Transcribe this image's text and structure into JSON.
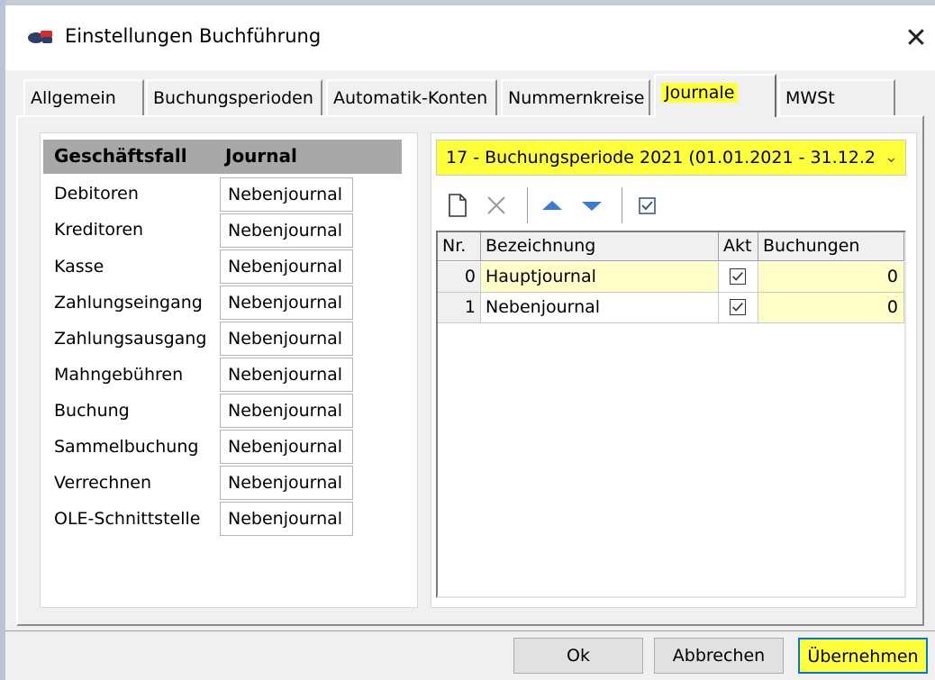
{
  "window": {
    "title": "Einstellungen Buchführung",
    "close_label": "✕"
  },
  "tabs": [
    {
      "label": "Allgemein"
    },
    {
      "label": "Buchungsperioden"
    },
    {
      "label": "Automatik-Konten"
    },
    {
      "label": "Nummernkreise"
    },
    {
      "label": "Journale",
      "active": true
    },
    {
      "label": "MWSt"
    }
  ],
  "left_table": {
    "col_business": "Geschäftsfall",
    "col_journal": "Journal",
    "rows": [
      {
        "label": "Debitoren",
        "value": "Nebenjournal"
      },
      {
        "label": "Kreditoren",
        "value": "Nebenjournal"
      },
      {
        "label": "Kasse",
        "value": "Nebenjournal"
      },
      {
        "label": "Zahlungseingang",
        "value": "Nebenjournal"
      },
      {
        "label": "Zahlungsausgang",
        "value": "Nebenjournal"
      },
      {
        "label": "Mahngebühren",
        "value": "Nebenjournal"
      },
      {
        "label": "Buchung",
        "value": "Nebenjournal"
      },
      {
        "label": "Sammelbuchung",
        "value": "Nebenjournal"
      },
      {
        "label": "Verrechnen",
        "value": "Nebenjournal"
      },
      {
        "label": "OLE-Schnittstelle",
        "value": "Nebenjournal"
      }
    ]
  },
  "period_select": {
    "value": "17 - Buchungsperiode 2021 (01.01.2021 - 31.12.2"
  },
  "journal_grid": {
    "headers": {
      "nr": "Nr.",
      "name": "Bezeichnung",
      "active": "Akt",
      "bookings": "Buchungen"
    },
    "rows": [
      {
        "nr": "0",
        "name": "Hauptjournal",
        "active": true,
        "bookings": "0"
      },
      {
        "nr": "1",
        "name": "Nebenjournal",
        "active": true,
        "bookings": "0"
      }
    ]
  },
  "buttons": {
    "ok": "Ok",
    "cancel": "Abbrechen",
    "apply": "Übernehmen"
  },
  "colors": {
    "highlight": "#ffff3c",
    "accent_blue": "#3a7bd5"
  }
}
